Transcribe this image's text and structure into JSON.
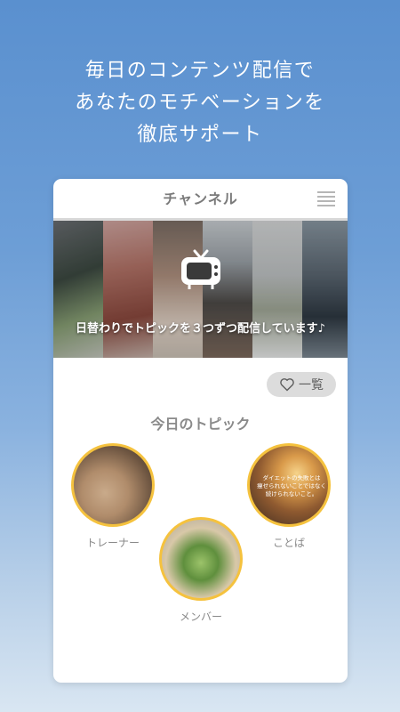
{
  "promo": {
    "lines": [
      "毎日のコンテンツ配信で",
      "あなたのモチベーションを",
      "徹底サポート"
    ]
  },
  "card": {
    "title": "チャンネル",
    "banner_caption": "日替わりでトピックを３つずつ配信しています♪",
    "list_button_label": "一覧",
    "topics_title": "今日のトピック",
    "topics": [
      {
        "label": "トレーナー"
      },
      {
        "label": "ことば",
        "image_text": [
          "ダイエットの失敗とは",
          "痩せられないことではなく",
          "続けられないこと。"
        ]
      },
      {
        "label": "メンバー"
      }
    ]
  },
  "colors": {
    "accent_ring": "#f5c23e",
    "sky_top": "#5a90cf"
  },
  "icons": {
    "menu": "hamburger-menu-icon",
    "tv": "tv-icon",
    "heart": "heart-outline-icon"
  }
}
